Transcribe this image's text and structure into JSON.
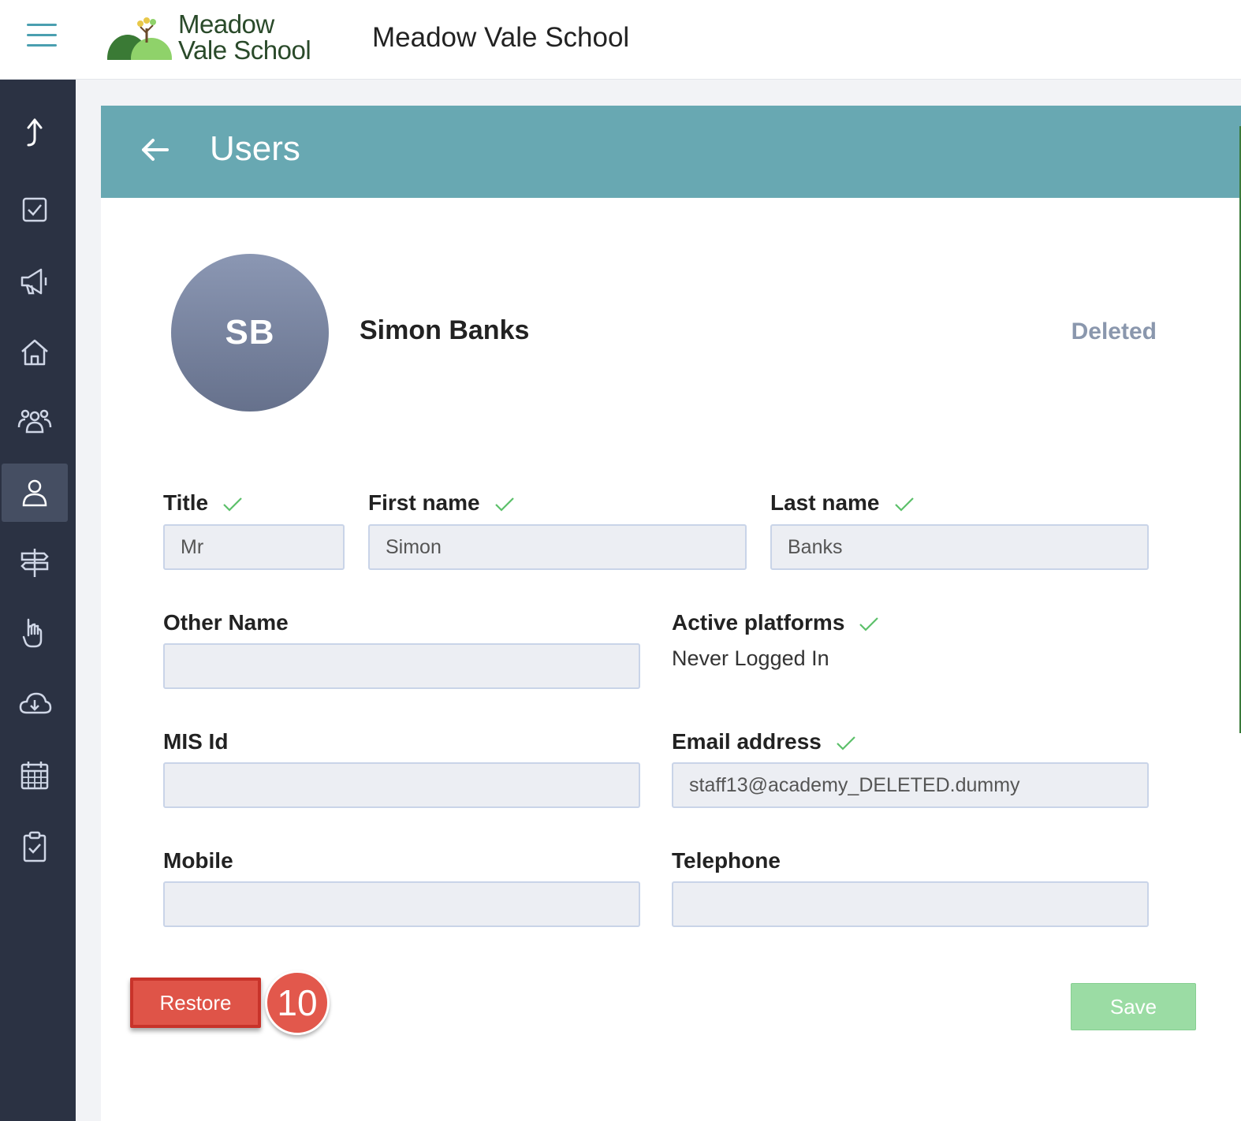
{
  "header": {
    "logo_line1": "Meadow",
    "logo_line2": "Vale School",
    "school_name": "Meadow Vale School"
  },
  "sidebar": {
    "items": [
      {
        "icon": "arrow-up-icon"
      },
      {
        "icon": "checkbox-icon"
      },
      {
        "icon": "megaphone-icon"
      },
      {
        "icon": "home-icon"
      },
      {
        "icon": "group-icon"
      },
      {
        "icon": "user-icon",
        "active": true
      },
      {
        "icon": "signpost-icon"
      },
      {
        "icon": "hand-icon"
      },
      {
        "icon": "cloud-download-icon"
      },
      {
        "icon": "calendar-icon"
      },
      {
        "icon": "clipboard-check-icon"
      }
    ]
  },
  "panel": {
    "title": "Users",
    "user": {
      "initials": "SB",
      "name": "Simon Banks",
      "status": "Deleted"
    },
    "fields": {
      "title": {
        "label": "Title",
        "value": "Mr"
      },
      "first_name": {
        "label": "First name",
        "value": "Simon"
      },
      "last_name": {
        "label": "Last name",
        "value": "Banks"
      },
      "other_name": {
        "label": "Other Name",
        "value": ""
      },
      "active_platforms": {
        "label": "Active platforms",
        "value": "Never Logged In"
      },
      "mis_id": {
        "label": "MIS Id",
        "value": ""
      },
      "email": {
        "label": "Email address",
        "value": "staff13@academy_DELETED.dummy"
      },
      "mobile": {
        "label": "Mobile",
        "value": ""
      },
      "telephone": {
        "label": "Telephone",
        "value": ""
      }
    },
    "restore_label": "Restore",
    "save_label": "Save",
    "step_number": "10"
  },
  "colors": {
    "sidebar": "#2b3243",
    "header_band": "#68a8b2",
    "restore": "#df5448",
    "save": "#9bdca4",
    "check": "#5cc06a"
  }
}
